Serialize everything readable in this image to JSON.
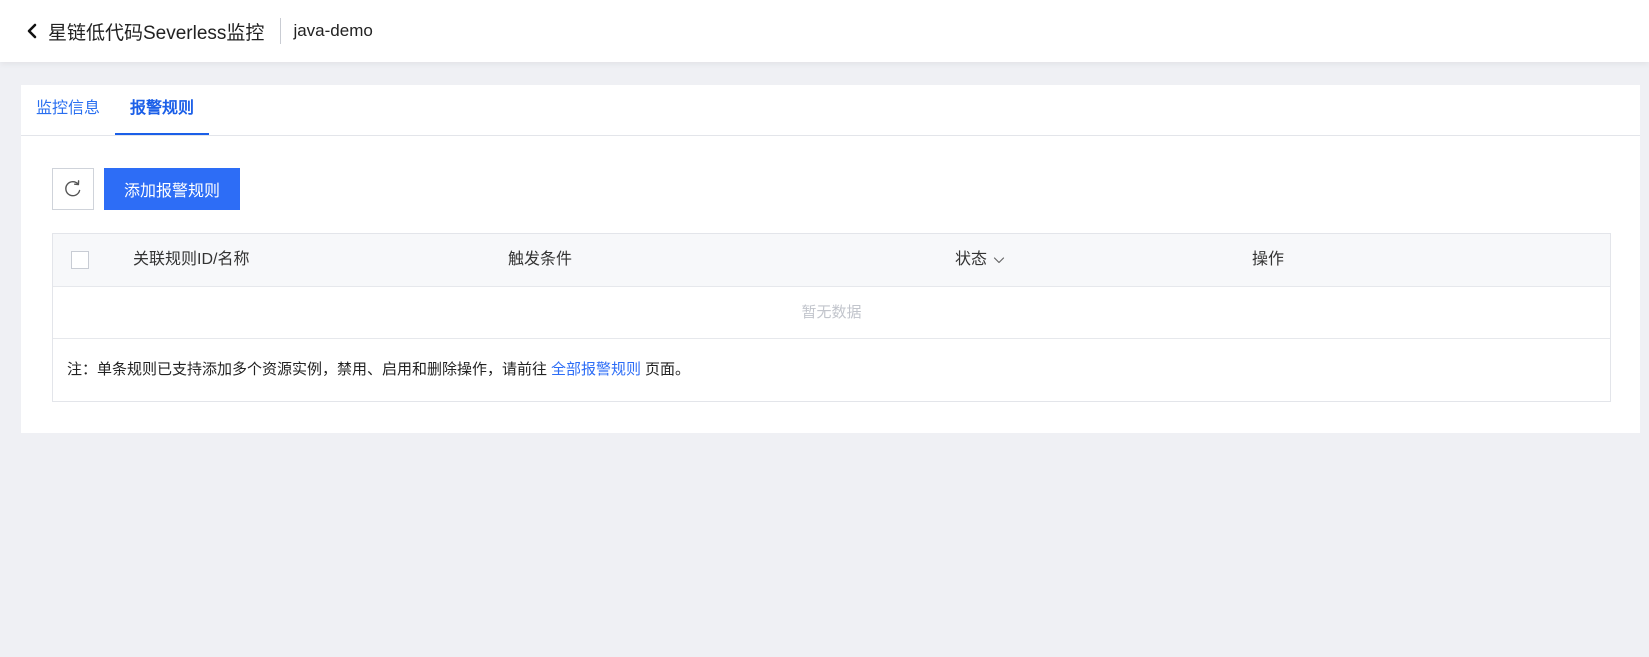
{
  "header": {
    "back_icon": "chevron-left-icon",
    "title": "星链低代码Severless监控",
    "app_name": "java-demo"
  },
  "tabs": [
    {
      "label": "监控信息",
      "active": false
    },
    {
      "label": "报警规则",
      "active": true
    }
  ],
  "toolbar": {
    "refresh_icon": "refresh-icon",
    "add_label": "添加报警规则"
  },
  "table": {
    "columns": [
      "关联规则ID/名称",
      "触发条件",
      "状态",
      "操作"
    ],
    "empty_text": "暂无数据"
  },
  "note": {
    "prefix": "注：单条规则已支持添加多个资源实例，禁用、启用和删除操作，请前往",
    "link": "全部报警规则",
    "suffix": "页面。"
  },
  "colors": {
    "accent": "#2d6df6",
    "background": "#eff0f4"
  }
}
